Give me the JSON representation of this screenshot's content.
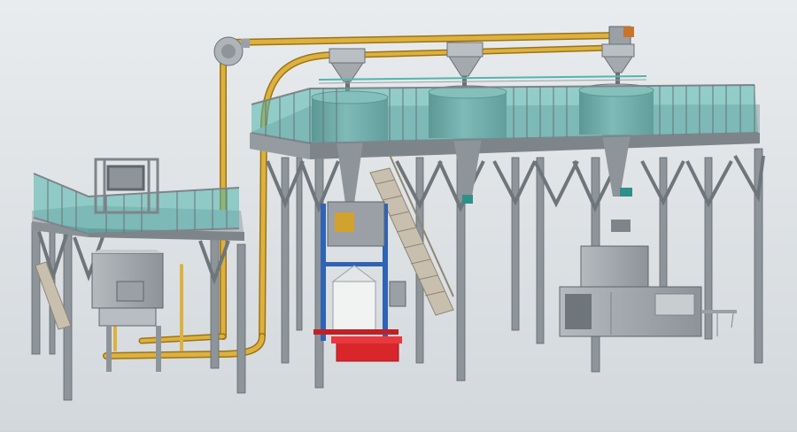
{
  "scene": {
    "kind": "3d-render",
    "colors": {
      "background_top": "#e9ecee",
      "background_bottom": "#d3d8dc",
      "steel": "#8d949a",
      "steel_dark": "#5f666c",
      "steel_light": "#b7bdc2",
      "railing_glass": "#4fb7ad",
      "pipe": "#d2a22e",
      "pipe_dark": "#9c7414",
      "frame_blue": "#2f63b5",
      "pallet_red": "#d9262b",
      "bag_white": "#f1f2f2",
      "stair": "#c8bfae"
    }
  }
}
